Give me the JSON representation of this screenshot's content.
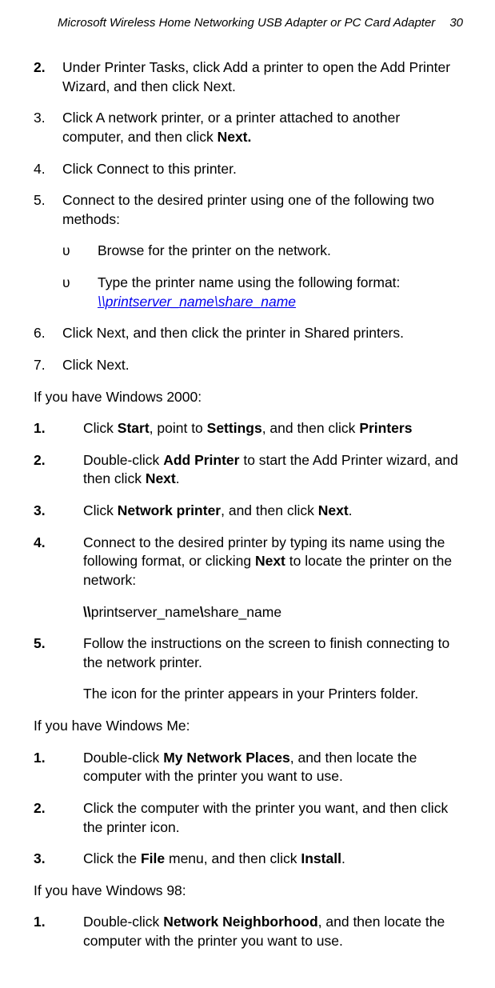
{
  "header": {
    "title": "Microsoft Wireless Home Networking USB Adapter or PC Card Adapter",
    "page_num": "30"
  },
  "content": {
    "s2_num": "2.",
    "s2_text": "Under Printer Tasks, click Add a printer to open the Add Printer Wizard, and then click Next.",
    "s3_num": "3.",
    "s3_a": "Click A network printer, or a printer attached to another computer, and then click ",
    "s3_b": "Next.",
    "s4_num": "4.",
    "s4_text": "Click Connect to this printer.",
    "s5_num": "5.",
    "s5_text": "Connect to the desired printer using one of the following two methods:",
    "bul": "υ",
    "b1": "Browse for the printer on the network.",
    "b2a": "Type the printer name using the following format: ",
    "b2link": "\\\\printserver_name\\share_name",
    "s6_num": "6.",
    "s6_text": "Click Next, and then click the printer in Shared printers.",
    "s7_num": "7.",
    "s7_text": "Click Next.",
    "win2000": "If you have Windows 2000:",
    "w1_num": "1.",
    "w1_a": "Click ",
    "w1_b": "Start",
    "w1_c": ", point to ",
    "w1_d": "Settings",
    "w1_e": ", and then click ",
    "w1_f": "Printers",
    "w2_num": "2.",
    "w2_a": "Double-click ",
    "w2_b": "Add Printer",
    "w2_c": " to start the Add Printer wizard, and then click ",
    "w2_d": "Next",
    "w2_e": ".",
    "w3_num": "3.",
    "w3_a": "Click ",
    "w3_b": "Network printer",
    "w3_c": ", and then click ",
    "w3_d": "Next",
    "w3_e": ".",
    "w4_num": "4.",
    "w4_a": "Connect to the desired printer by typing its name using the following format, or clicking ",
    "w4_b": "Next",
    "w4_c": " to locate the printer on the network:",
    "path_a": "\\\\",
    "path_b": "printserver_name",
    "path_c": "\\",
    "path_d": "share_name",
    "w5_num": "5.",
    "w5_text": "Follow the instructions on the screen to finish connecting to the network printer.",
    "w5_after": "The icon for the printer appears in your Printers folder.",
    "winme": "If you have Windows Me:",
    "m1_num": "1.",
    "m1_a": "Double-click ",
    "m1_b": "My Network Places",
    "m1_c": ", and then locate the computer with the printer you want to use.",
    "m2_num": "2.",
    "m2_text": "Click the computer with the printer you want, and then click the printer icon.",
    "m3_num": "3.",
    "m3_a": "Click the ",
    "m3_b": "File",
    "m3_c": " menu, and then click ",
    "m3_d": "Install",
    "m3_e": ".",
    "win98": "If you have Windows 98:",
    "n1_num": "1.",
    "n1_a": "Double-click ",
    "n1_b": "Network Neighborhood",
    "n1_c": ", and then locate the computer with the printer you want to use."
  }
}
